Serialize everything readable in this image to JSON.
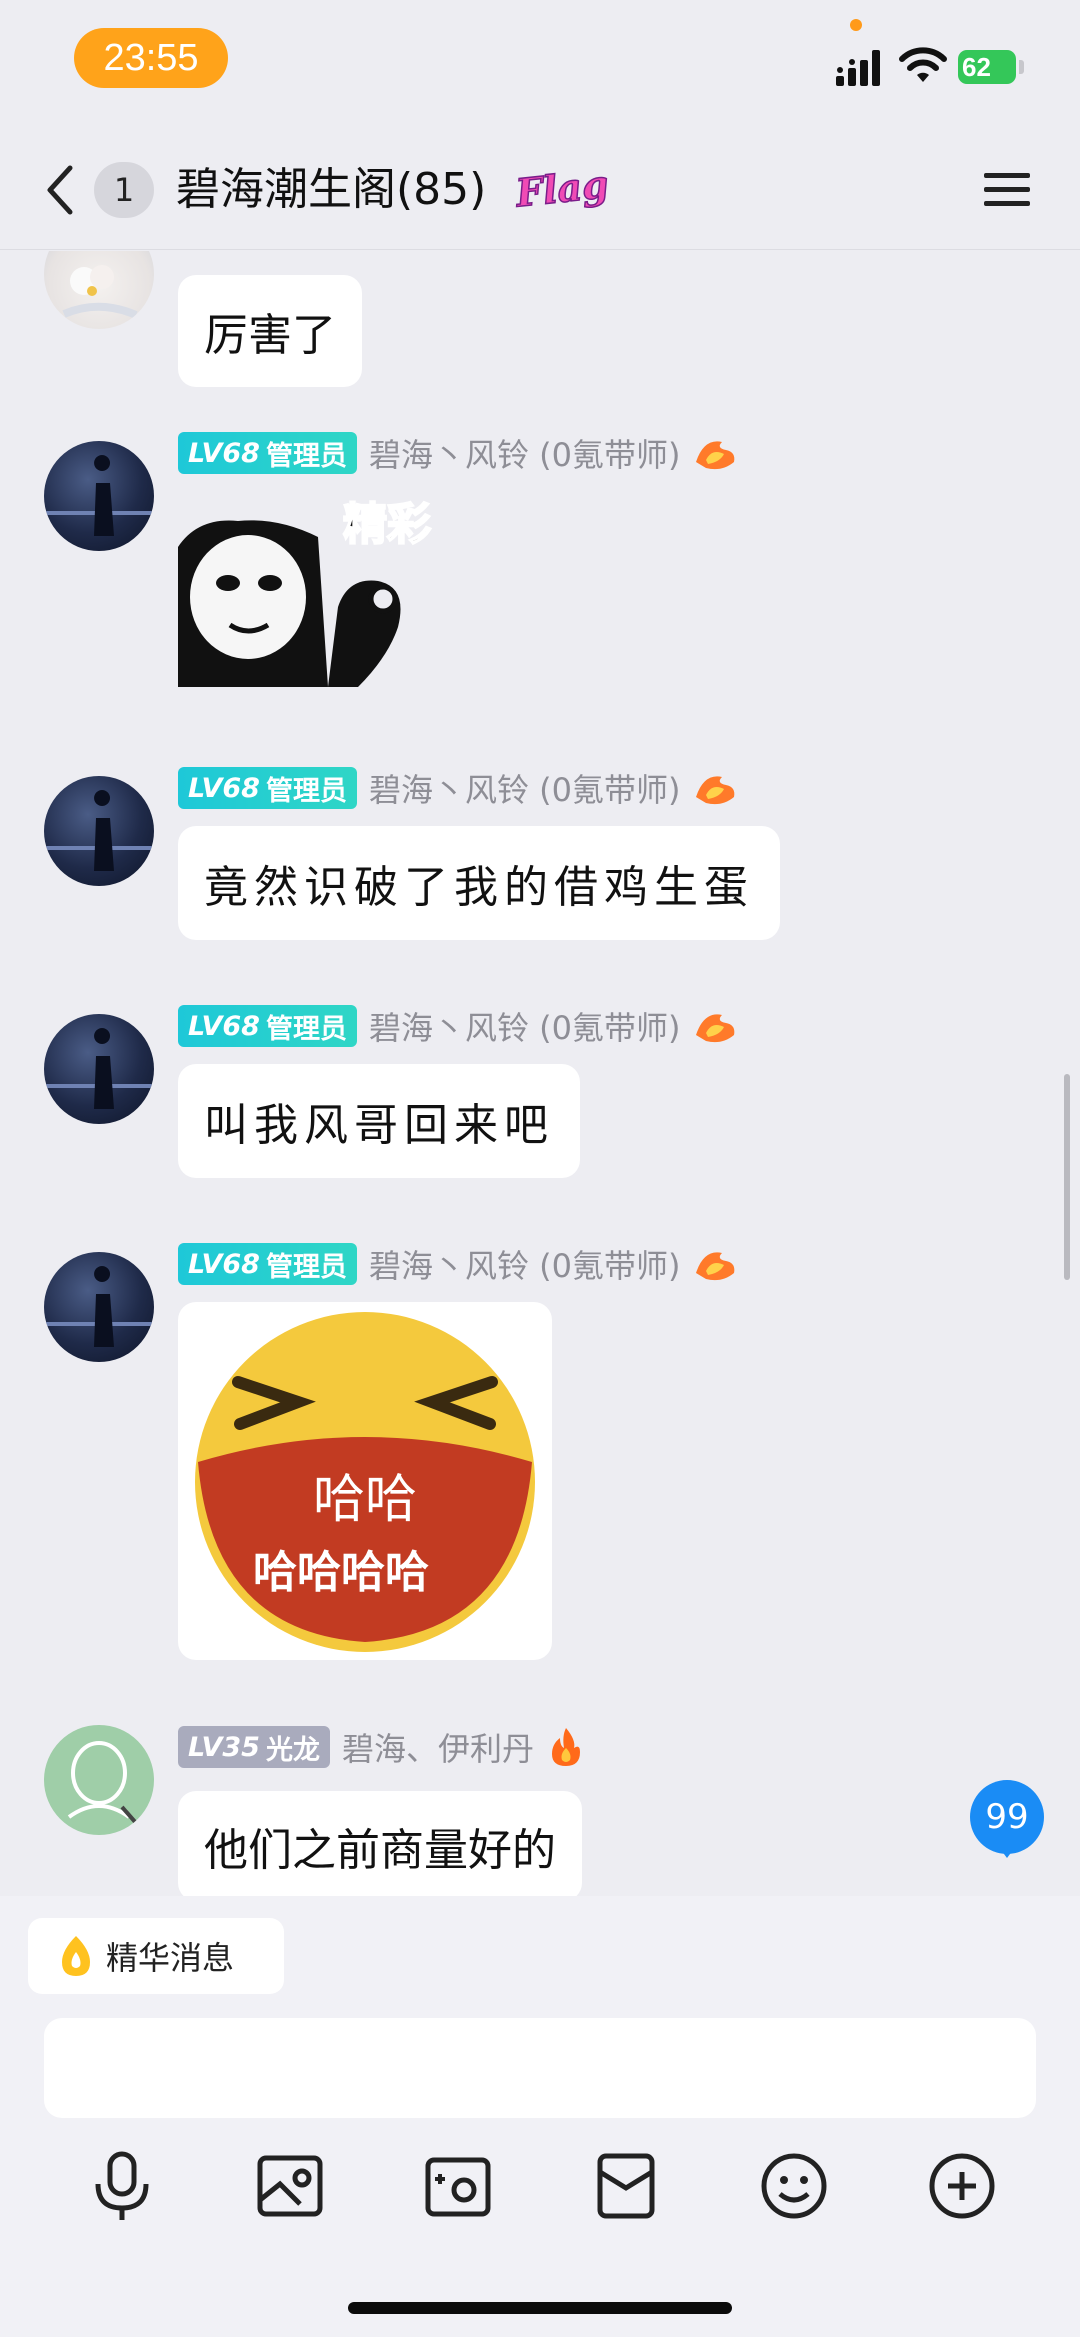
{
  "status_bar": {
    "time": "23:55",
    "battery": "62"
  },
  "header": {
    "unread_count": "1",
    "title": "碧海潮生阁(85)",
    "flag_text": "Flag"
  },
  "messages": [
    {
      "text": "厉害了"
    },
    {
      "level": "LV68",
      "role": "管理员",
      "sender": "碧海丶风铃 (0氪带师)",
      "sticker_text": "精彩"
    },
    {
      "level": "LV68",
      "role": "管理员",
      "sender": "碧海丶风铃 (0氪带师)",
      "text": "竟然识破了我的借鸡生蛋"
    },
    {
      "level": "LV68",
      "role": "管理员",
      "sender": "碧海丶风铃 (0氪带师)",
      "text": "叫我风哥回来吧"
    },
    {
      "level": "LV68",
      "role": "管理员",
      "sender": "碧海丶风铃 (0氪带师)",
      "sticker_text_1": "哈哈",
      "sticker_text_2": "哈哈哈哈"
    },
    {
      "level": "LV35",
      "role": "光龙",
      "sender": "碧海、伊利丹",
      "text": "他们之前商量好的"
    }
  ],
  "floating_badge": "99",
  "input": {
    "essence_label": "精华消息"
  },
  "icons": {
    "back": "chevron-left-icon",
    "menu": "menu-icon",
    "mic": "microphone-icon",
    "image": "image-icon",
    "camera": "camera-icon",
    "redpacket": "red-packet-icon",
    "emoji": "emoji-icon",
    "plus": "plus-icon"
  },
  "colors": {
    "time_pill": "#ffa31a",
    "admin_badge": "#1ec8d8",
    "unread_badge": "#1a8cf5",
    "battery": "#34c759"
  }
}
